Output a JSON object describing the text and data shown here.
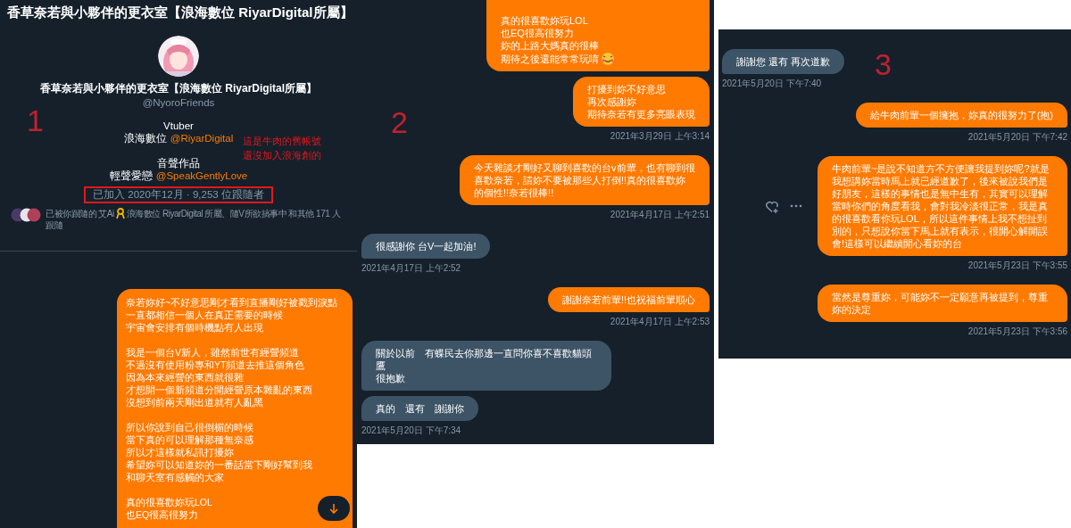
{
  "panel_1": {
    "annotation": "1",
    "header_title": "香草奈若與小夥伴的更衣室【浪海數位 RiyarDigital所屬】",
    "profile": {
      "kind": "picture",
      "name": "香草奈若與小夥伴的更衣室【浪海數位 RiyarDigital所屬】",
      "handle": "@NyoroFriends",
      "bio": [
        [
          {
            "text": "Vtuber"
          },
          {
            "text": "浪海數位",
            "link": "@RiyarDigital"
          }
        ],
        [
          {
            "text": "音聲作品"
          },
          {
            "text": "輕聲愛戀",
            "link": "@SpeakGentlyLove"
          }
        ]
      ],
      "join_info": "已加入 2020年12月 · 9,253 位跟隨者",
      "join_highlighted": true,
      "followed_by_before_icon": "已被你跟隨的 艾Ai",
      "followed_by_after_icon": "浪海數位 RiyarDigital 所屬、隨V所欲搞事中 和其他 171 人",
      "followed_by_second_line": "跟隨"
    },
    "note": [
      "這是牛肉的舊帳號",
      "還沒加入浪海創的"
    ],
    "items": [
      {
        "kind": "sent",
        "paragraphs": [
          [
            "奈若妳好~不好意思剛才看到直播剛好被戳到淚點",
            "一直都相信一個人在真正需要的時候",
            "宇宙會安排有個時機點有人出現"
          ],
          [
            "我是一個台V新人，雖然前世有經營頻道",
            "不過沒有使用粉專和YT頻道去推這個角色",
            "因為本來經營的東西就很雜",
            "才想開一個新頻道分開經營原本雜亂的東西",
            "沒想到前兩天剛出道就有人亂黑"
          ],
          [
            "所以你說到自己很倒楣的時候",
            "當下真的可以理解那種無奈感",
            "所以才這樣就私訊打擾妳",
            "希望妳可以知道妳的一番話當下剛好幫到我",
            "和聊天室有感觸的大家"
          ],
          [
            "真的很喜歡妳玩LOL",
            "也EQ很高很努力"
          ]
        ]
      }
    ]
  },
  "panel_2": {
    "annotation": "2",
    "items": [
      {
        "kind": "sent",
        "paragraphs": [
          [
            "真的很喜歡妳玩LOL",
            "也EQ很高很努力",
            "妳的上路大媽真的很棒",
            "期待之後還能常常玩唷"
          ]
        ],
        "trailing_emoji": true
      },
      {
        "kind": "sent",
        "paragraphs": [
          [
            "打擾到妳不好意思",
            "再次感謝妳",
            "期待奈若有更多亮眼表現"
          ]
        ]
      },
      {
        "kind": "time",
        "text": "2021年3月29日 上午3:14"
      },
      {
        "kind": "sent",
        "paragraphs": [
          [
            "今天雜談才剛好又聊到喜歡的台v前輩，也有聊到很喜歡奈若，請妳不要被那些人打倒!!真的很喜歡妳的個性!!奈若很棒!!"
          ]
        ]
      },
      {
        "kind": "time",
        "text": "2021年4月17日 上午2:51"
      },
      {
        "kind": "received",
        "paragraphs": [
          [
            "很感謝你 台V一起加油!"
          ]
        ]
      },
      {
        "kind": "time",
        "text": "2021年4月17日 上午2:52"
      },
      {
        "kind": "sent",
        "paragraphs": [
          [
            "謝謝奈若前輩!!也祝福前輩順心"
          ]
        ]
      },
      {
        "kind": "time",
        "text": "2021年4月17日 上午2:53"
      },
      {
        "kind": "received",
        "paragraphs": [
          [
            "關於以前　有蝶民去你那邊一直問你喜不喜歡貓頭鷹",
            "很抱歉"
          ]
        ]
      },
      {
        "kind": "received",
        "paragraphs": [
          [
            "真的　還有　謝謝你"
          ]
        ]
      },
      {
        "kind": "time",
        "text": "2021年5月20日 下午7:34"
      }
    ]
  },
  "panel_3": {
    "annotation": "3",
    "items": [
      {
        "kind": "received",
        "paragraphs": [
          [
            "謝謝您 還有 再次道歉"
          ]
        ]
      },
      {
        "kind": "time",
        "text": "2021年5月20日 下午7:40"
      },
      {
        "kind": "sent",
        "paragraphs": [
          [
            "給牛肉前輩一個擁抱，妳真的很努力了(抱)"
          ]
        ]
      },
      {
        "kind": "time",
        "text": "2021年5月20日 下午7:42"
      },
      {
        "kind": "sent",
        "paragraphs": [
          [
            "牛肉前輩~是說不知道方不方便讓我提到妳呢?就是我想講妳當時馬上就已經道歉了，後來被說我們是好朋友，這樣的事情也是無中生有，其實可以理解當時你們的角度看我，會對我冷淡很正常，我是真的很喜歡看你玩LOL，所以這件事情上我不想扯到別的，只想說你當下馬上就有表示，很開心解開誤會!這樣可以繼續開心看妳的台"
          ]
        ],
        "hover_actions": true
      },
      {
        "kind": "time",
        "text": "2021年5月23日 下午3:55"
      },
      {
        "kind": "sent",
        "paragraphs": [
          [
            "當然是尊重妳，可能妳不一定願意再被提到，尊重妳的決定"
          ]
        ]
      },
      {
        "kind": "time",
        "text": "2021年5月23日 下午3:56"
      }
    ]
  }
}
